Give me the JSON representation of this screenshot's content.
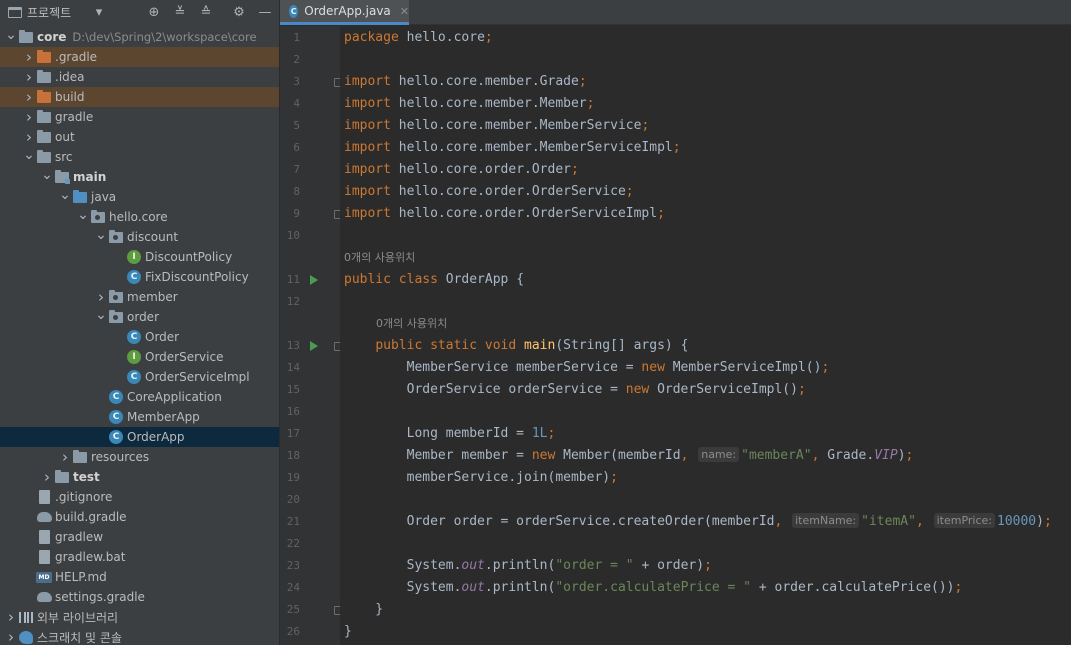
{
  "project_panel": {
    "title": "프로젝트",
    "tree": [
      {
        "label": "core",
        "path": "D:\\dev\\Spring\\2\\workspace\\core",
        "indent": 0,
        "arrow": "down",
        "icon": "module",
        "bold": true
      },
      {
        "label": ".gradle",
        "indent": 1,
        "arrow": "right",
        "icon": "folder-orange",
        "excluded": true
      },
      {
        "label": ".idea",
        "indent": 1,
        "arrow": "right",
        "icon": "folder"
      },
      {
        "label": "build",
        "indent": 1,
        "arrow": "right",
        "icon": "folder-orange",
        "excluded": true
      },
      {
        "label": "gradle",
        "indent": 1,
        "arrow": "right",
        "icon": "folder"
      },
      {
        "label": "out",
        "indent": 1,
        "arrow": "right",
        "icon": "folder"
      },
      {
        "label": "src",
        "indent": 1,
        "arrow": "down",
        "icon": "folder"
      },
      {
        "label": "main",
        "indent": 2,
        "arrow": "down",
        "icon": "folder-src",
        "bold": true
      },
      {
        "label": "java",
        "indent": 3,
        "arrow": "down",
        "icon": "folder-blue"
      },
      {
        "label": "hello.core",
        "indent": 4,
        "arrow": "down",
        "icon": "package"
      },
      {
        "label": "discount",
        "indent": 5,
        "arrow": "down",
        "icon": "package"
      },
      {
        "label": "DiscountPolicy",
        "indent": 6,
        "icon": "interface"
      },
      {
        "label": "FixDiscountPolicy",
        "indent": 6,
        "icon": "class"
      },
      {
        "label": "member",
        "indent": 5,
        "arrow": "right",
        "icon": "package"
      },
      {
        "label": "order",
        "indent": 5,
        "arrow": "down",
        "icon": "package"
      },
      {
        "label": "Order",
        "indent": 6,
        "icon": "class"
      },
      {
        "label": "OrderService",
        "indent": 6,
        "icon": "interface"
      },
      {
        "label": "OrderServiceImpl",
        "indent": 6,
        "icon": "class"
      },
      {
        "label": "CoreApplication",
        "indent": 5,
        "icon": "class-run"
      },
      {
        "label": "MemberApp",
        "indent": 5,
        "icon": "class-run"
      },
      {
        "label": "OrderApp",
        "indent": 5,
        "icon": "class-run",
        "selected": true
      },
      {
        "label": "resources",
        "indent": 3,
        "arrow": "right",
        "icon": "folder-res"
      },
      {
        "label": "test",
        "indent": 2,
        "arrow": "right",
        "icon": "folder",
        "bold": true
      },
      {
        "label": ".gitignore",
        "indent": 1,
        "icon": "file"
      },
      {
        "label": "build.gradle",
        "indent": 1,
        "icon": "gradle"
      },
      {
        "label": "gradlew",
        "indent": 1,
        "icon": "file"
      },
      {
        "label": "gradlew.bat",
        "indent": 1,
        "icon": "file"
      },
      {
        "label": "HELP.md",
        "indent": 1,
        "icon": "md"
      },
      {
        "label": "settings.gradle",
        "indent": 1,
        "icon": "gradle"
      },
      {
        "label": "외부 라이브러리",
        "indent": 0,
        "arrow": "right",
        "icon": "library"
      },
      {
        "label": "스크래치 및 콘솔",
        "indent": 0,
        "arrow": "right",
        "icon": "scratch"
      }
    ]
  },
  "editor": {
    "tab_label": "OrderApp.java",
    "usage_hint": "0개의 사용위치",
    "line_numbers": [
      "1",
      "2",
      "3",
      "4",
      "5",
      "6",
      "7",
      "8",
      "9",
      "10",
      "11",
      "12",
      "13",
      "14",
      "15",
      "16",
      "17",
      "18",
      "19",
      "20",
      "21",
      "22",
      "23",
      "24",
      "25",
      "26"
    ],
    "lines": [
      [
        {
          "t": "package ",
          "c": "kw"
        },
        {
          "t": "hello.core"
        },
        {
          "t": ";",
          "c": "kw"
        }
      ],
      [],
      [
        {
          "t": "import ",
          "c": "kw"
        },
        {
          "t": "hello.core.member.Grade"
        },
        {
          "t": ";",
          "c": "kw"
        }
      ],
      [
        {
          "t": "import ",
          "c": "kw"
        },
        {
          "t": "hello.core.member.Member"
        },
        {
          "t": ";",
          "c": "kw"
        }
      ],
      [
        {
          "t": "import ",
          "c": "kw"
        },
        {
          "t": "hello.core.member.MemberService"
        },
        {
          "t": ";",
          "c": "kw"
        }
      ],
      [
        {
          "t": "import ",
          "c": "kw"
        },
        {
          "t": "hello.core.member.MemberServiceImpl"
        },
        {
          "t": ";",
          "c": "kw"
        }
      ],
      [
        {
          "t": "import ",
          "c": "kw"
        },
        {
          "t": "hello.core.order.Order"
        },
        {
          "t": ";",
          "c": "kw"
        }
      ],
      [
        {
          "t": "import ",
          "c": "kw"
        },
        {
          "t": "hello.core.order.OrderService"
        },
        {
          "t": ";",
          "c": "kw"
        }
      ],
      [
        {
          "t": "import ",
          "c": "kw"
        },
        {
          "t": "hello.core.order.OrderServiceImpl"
        },
        {
          "t": ";",
          "c": "kw"
        }
      ],
      [],
      [
        {
          "t": "public class ",
          "c": "kw"
        },
        {
          "t": "OrderApp {"
        }
      ],
      [],
      [
        {
          "t": "    "
        },
        {
          "t": "public static void ",
          "c": "kw"
        },
        {
          "t": "main",
          "c": "fn"
        },
        {
          "t": "(String[] args) {"
        }
      ],
      [
        {
          "t": "        MemberService memberService = "
        },
        {
          "t": "new ",
          "c": "kw"
        },
        {
          "t": "MemberServiceImpl()"
        },
        {
          "t": ";",
          "c": "kw"
        }
      ],
      [
        {
          "t": "        OrderService orderService = "
        },
        {
          "t": "new ",
          "c": "kw"
        },
        {
          "t": "OrderServiceImpl()"
        },
        {
          "t": ";",
          "c": "kw"
        }
      ],
      [],
      [
        {
          "t": "        Long memberId = "
        },
        {
          "t": "1L",
          "c": "num"
        },
        {
          "t": ";",
          "c": "kw"
        }
      ],
      [
        {
          "t": "        Member member = "
        },
        {
          "t": "new ",
          "c": "kw"
        },
        {
          "t": "Member(memberId"
        },
        {
          "t": ", ",
          "c": "kw"
        },
        {
          "t": "name:",
          "c": "inlay"
        },
        {
          "t": "\"memberA\"",
          "c": "str"
        },
        {
          "t": ", ",
          "c": "kw"
        },
        {
          "t": "Grade."
        },
        {
          "t": "VIP",
          "c": "stat"
        },
        {
          "t": ")"
        },
        {
          "t": ";",
          "c": "kw"
        }
      ],
      [
        {
          "t": "        memberService.join(member)"
        },
        {
          "t": ";",
          "c": "kw"
        }
      ],
      [],
      [
        {
          "t": "        Order order = orderService.createOrder(memberId"
        },
        {
          "t": ", ",
          "c": "kw"
        },
        {
          "t": "itemName:",
          "c": "inlay"
        },
        {
          "t": "\"itemA\"",
          "c": "str"
        },
        {
          "t": ", ",
          "c": "kw"
        },
        {
          "t": "itemPrice:",
          "c": "inlay"
        },
        {
          "t": "10000",
          "c": "num"
        },
        {
          "t": ")"
        },
        {
          "t": ";",
          "c": "kw"
        }
      ],
      [],
      [
        {
          "t": "        System."
        },
        {
          "t": "out",
          "c": "stat"
        },
        {
          "t": ".println("
        },
        {
          "t": "\"order = \"",
          "c": "str"
        },
        {
          "t": " + order)"
        },
        {
          "t": ";",
          "c": "kw"
        }
      ],
      [
        {
          "t": "        System."
        },
        {
          "t": "out",
          "c": "stat"
        },
        {
          "t": ".println("
        },
        {
          "t": "\"order.calculatePrice = \"",
          "c": "str"
        },
        {
          "t": " + order.calculatePrice())"
        },
        {
          "t": ";",
          "c": "kw"
        }
      ],
      [
        {
          "t": "    }"
        }
      ],
      [
        {
          "t": "}"
        }
      ]
    ]
  },
  "colors": {
    "panel_bg": "#3c3f41",
    "editor_bg": "#2b2b2b",
    "gutter_bg": "#313335",
    "keyword": "#cc7832",
    "string": "#6a8759",
    "number": "#6897bb",
    "method": "#ffc66d",
    "static_field": "#9876aa",
    "selection": "#0d293e",
    "excluded": "#5c4630",
    "run_marker": "#499c54"
  }
}
